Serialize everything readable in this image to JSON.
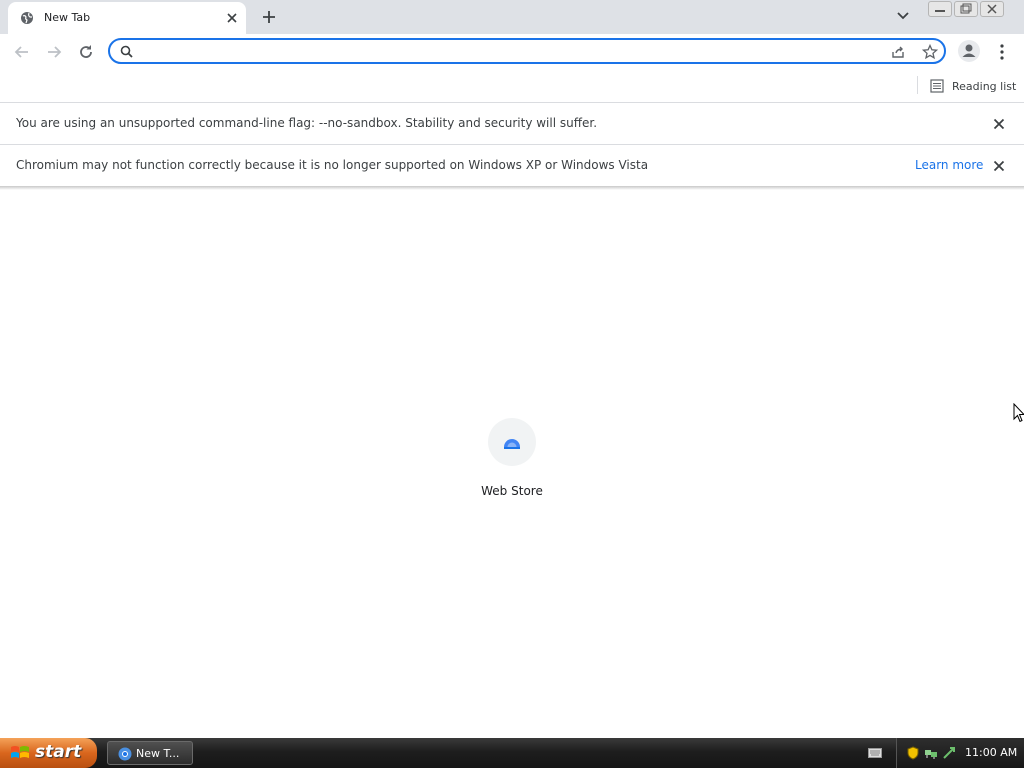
{
  "tab": {
    "title": "New Tab",
    "icon": "globe-icon"
  },
  "toolbar": {
    "omnibox_value": "",
    "omnibox_placeholder": ""
  },
  "bookmarks": {
    "reading_list_label": "Reading list"
  },
  "infobars": [
    {
      "message": "You are using an unsupported command-line flag: --no-sandbox. Stability and security will suffer."
    },
    {
      "message": "Chromium may not function correctly because it is no longer supported on Windows XP or Windows Vista",
      "link": "Learn more"
    }
  ],
  "shortcuts": [
    {
      "label": "Web Store",
      "icon": "web-store-icon"
    }
  ],
  "taskbar": {
    "start_label": "start",
    "task_label": "New T...",
    "clock": "11:00 AM"
  },
  "colors": {
    "accent": "#1a73e8",
    "tabstrip": "#dee1e6",
    "start": "#d9661d"
  }
}
